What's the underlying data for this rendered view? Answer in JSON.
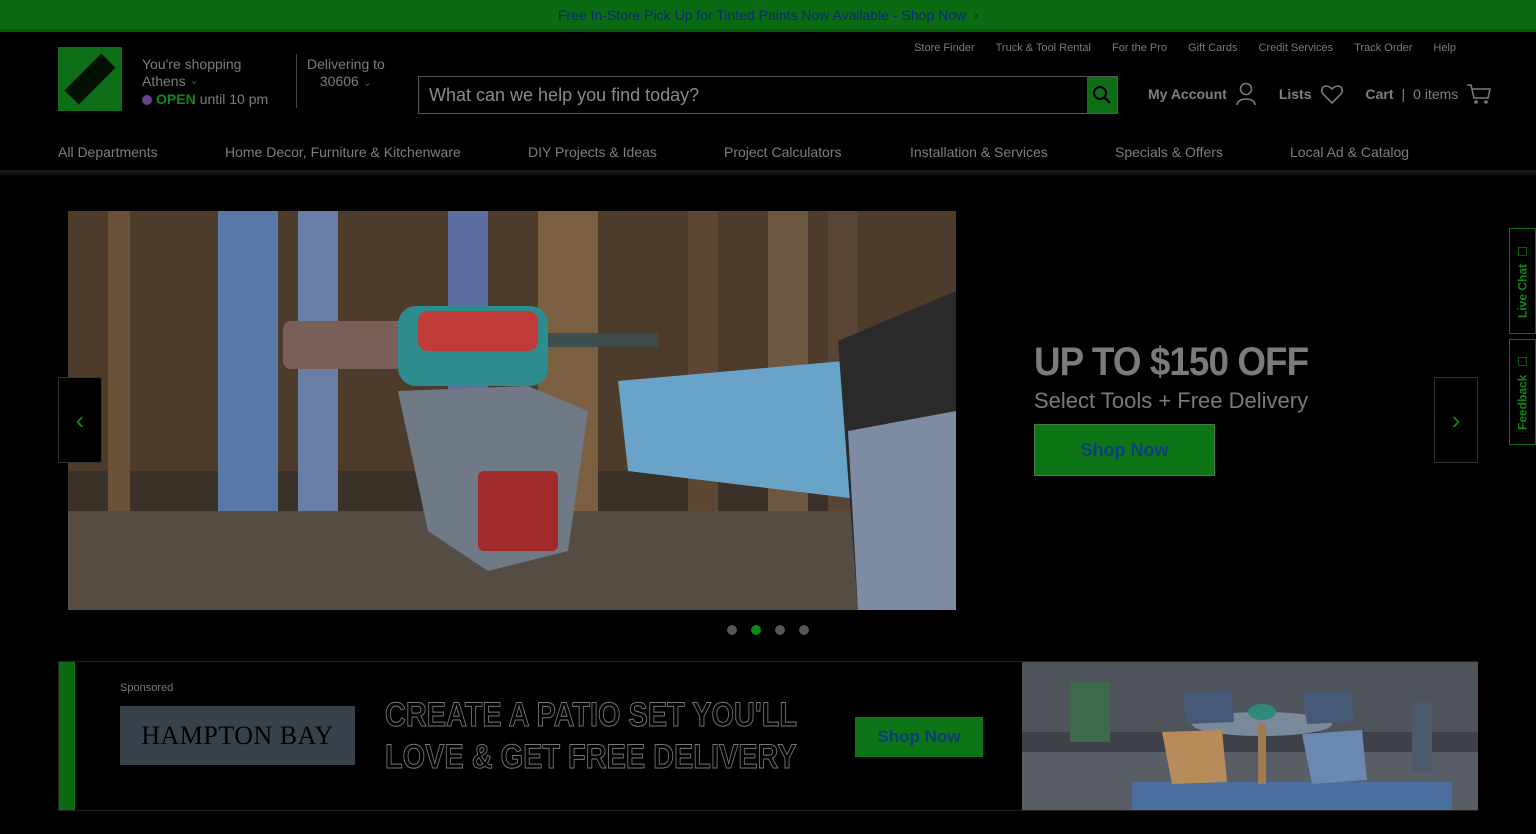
{
  "promo": {
    "text": "Free In-Store Pick Up for Tinted Paints Now Available - Shop Now",
    "chevron": "›"
  },
  "store": {
    "label": "You're shopping",
    "name": "Athens",
    "status": "OPEN",
    "hours": "until 10 pm"
  },
  "delivery": {
    "label": "Delivering to",
    "zip": "30606"
  },
  "search": {
    "placeholder": "What can we help you find today?"
  },
  "toplinks": [
    "Store Finder",
    "Truck & Tool Rental",
    "For the Pro",
    "Gift Cards",
    "Credit Services",
    "Track Order",
    "Help"
  ],
  "account": {
    "my_account": "My Account",
    "lists": "Lists",
    "cart": "Cart",
    "cart_items": "0 items"
  },
  "nav": [
    "All Departments",
    "Home Decor, Furniture & Kitchenware",
    "DIY Projects & Ideas",
    "Project Calculators",
    "Installation & Services",
    "Specials & Offers",
    "Local Ad & Catalog"
  ],
  "hero": {
    "headline": "UP TO $150 OFF",
    "subhead": "Select Tools + Free Delivery",
    "cta": "Shop Now",
    "prev": "‹",
    "next": "›",
    "active_slide": 2,
    "slide_count": 4
  },
  "side_tabs": {
    "live_chat": "Live Chat",
    "feedback": "Feedback"
  },
  "banner": {
    "sponsored": "Sponsored",
    "brand": "HAMPTON BAY",
    "line1": "CREATE A PATIO SET YOU'LL",
    "line2": "LOVE & GET FREE DELIVERY",
    "cta": "Shop Now"
  },
  "colors": {
    "brand_green": "#0c6e15",
    "accent_green": "#0c8a16",
    "background": "#000000"
  }
}
